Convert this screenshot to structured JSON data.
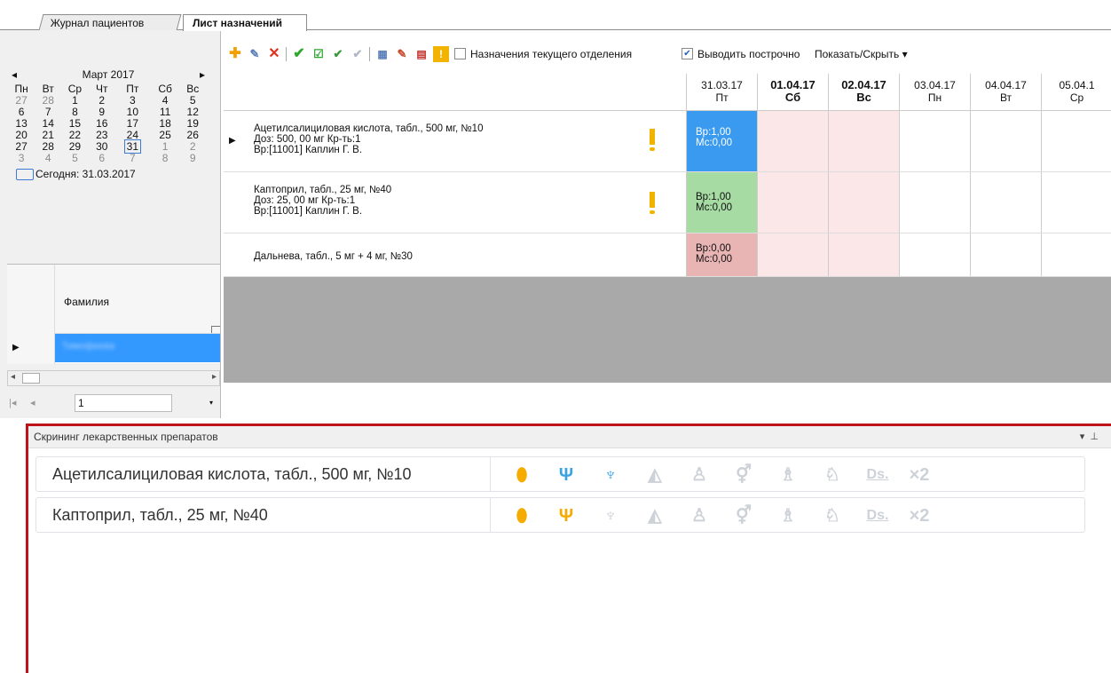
{
  "tabs": [
    "Журнал пациентов",
    "Лист назначений"
  ],
  "calendar": {
    "month_title": "Март 2017",
    "weekdays": [
      "Пн",
      "Вт",
      "Ср",
      "Чт",
      "Пт",
      "Сб",
      "Вс"
    ],
    "weeks": [
      [
        "27",
        "28",
        "1",
        "2",
        "3",
        "4",
        "5"
      ],
      [
        "6",
        "7",
        "8",
        "9",
        "10",
        "11",
        "12"
      ],
      [
        "13",
        "14",
        "15",
        "16",
        "17",
        "18",
        "19"
      ],
      [
        "20",
        "21",
        "22",
        "23",
        "24",
        "25",
        "26"
      ],
      [
        "27",
        "28",
        "29",
        "30",
        "31",
        "1",
        "2"
      ],
      [
        "3",
        "4",
        "5",
        "6",
        "7",
        "8",
        "9"
      ]
    ],
    "today_label": "Сегодня: 31.03.2017"
  },
  "patient_grid": {
    "column_header": "Фамилия",
    "selected_value": "Тимофеева"
  },
  "pager": {
    "page": "1"
  },
  "toolbar": {
    "filter_current_dept": "Назначения текущего отделения",
    "filter_current_dept_checked": false,
    "per_line": "Выводить построчно",
    "per_line_checked": true,
    "show_hide": "Показать/Скрыть"
  },
  "dates": [
    {
      "date": "31.03.17",
      "dow": "Пт",
      "bold": false
    },
    {
      "date": "01.04.17",
      "dow": "Сб",
      "bold": true
    },
    {
      "date": "02.04.17",
      "dow": "Вс",
      "bold": true
    },
    {
      "date": "03.04.17",
      "dow": "Пн",
      "bold": false
    },
    {
      "date": "04.04.17",
      "dow": "Вт",
      "bold": false
    },
    {
      "date": "05.04.1",
      "dow": "Ср",
      "bold": false
    }
  ],
  "prescriptions": [
    {
      "line1": "Ацетилсалициловая кислота, табл., 500 мг, №10",
      "line2": "Доз: 500, 00 мг Кр-ть:1",
      "line3": "Вр:[11001] Каплин Г. В.",
      "warn": true,
      "cell1": "Вр:1,00",
      "cell2": "Мс:0,00",
      "cell_color": "#3a9af0",
      "cell_text_color": "#ffffff"
    },
    {
      "line1": "Каптоприл, табл., 25 мг, №40",
      "line2": "Доз: 25, 00 мг Кр-ть:1",
      "line3": "Вр:[11001] Каплин Г. В.",
      "warn": true,
      "cell1": "Вр:1,00",
      "cell2": "Мс:0,00",
      "cell_color": "#a6dba4",
      "cell_text_color": "#222222"
    },
    {
      "line1": "Дальнева, табл., 5 мг + 4 мг, №30",
      "line2": "",
      "line3": "",
      "warn": false,
      "cell1": "Вр:0,00",
      "cell2": "Мс:0,00",
      "cell_color": "#e8b4b4",
      "cell_text_color": "#222222"
    }
  ],
  "screening": {
    "title": "Скрининг лекарственных препаратов",
    "drugs": [
      {
        "name": "Ацетилсалициловая кислота, табл., 500 мг, №10",
        "icons": [
          "pill-icon",
          "fork-knife-icon",
          "wine-glass-icon",
          "sun-icon",
          "children-icon",
          "gender-icon",
          "pregnancy-icon",
          "elderly-icon",
          "ds-icon",
          "x2-icon"
        ],
        "icon_states": [
          "yellow",
          "blue",
          "blue",
          "grey",
          "grey",
          "grey",
          "grey",
          "grey",
          "grey",
          "grey"
        ]
      },
      {
        "name": "Каптоприл, табл., 25 мг, №40",
        "icons": [
          "pill-icon",
          "fork-knife-icon",
          "wine-glass-icon",
          "sun-icon",
          "children-icon",
          "gender-icon",
          "pregnancy-icon",
          "elderly-icon",
          "ds-icon",
          "x2-icon"
        ],
        "icon_states": [
          "yellow",
          "yellow",
          "grey",
          "grey",
          "grey",
          "grey",
          "grey",
          "grey",
          "grey",
          "grey"
        ]
      }
    ],
    "x2_label": "×2",
    "ds_label": "Ds."
  }
}
